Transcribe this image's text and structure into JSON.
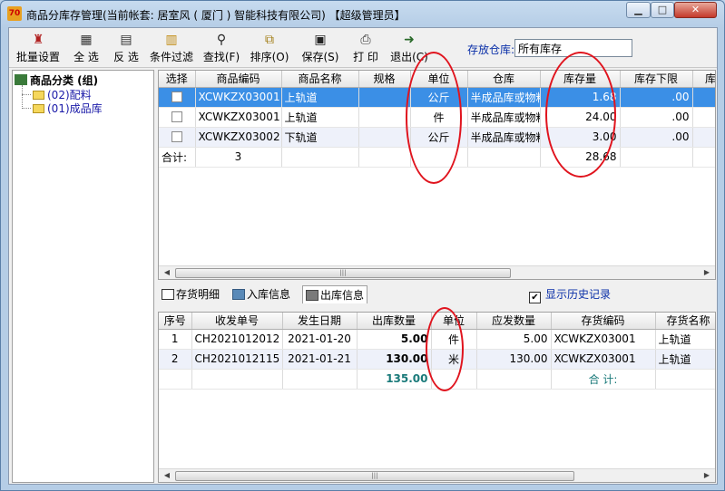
{
  "window": {
    "title": "商品分库存管理(当前帐套: 居室风 ( 厦门 ) 智能科技有限公司) 【超级管理员】",
    "app_icon_text": "70"
  },
  "toolbar": {
    "buttons": [
      {
        "label": "批量设置",
        "icon": "stamp-icon"
      },
      {
        "label": "全 选",
        "icon": "select-all-icon"
      },
      {
        "label": "反 选",
        "icon": "invert-select-icon"
      },
      {
        "label": "条件过滤",
        "icon": "filter-icon"
      },
      {
        "label": "查找(F)",
        "icon": "binoculars-icon"
      },
      {
        "label": "排序(O)",
        "icon": "sort-icon"
      },
      {
        "label": "保存(S)",
        "icon": "save-icon"
      },
      {
        "label": "打 印",
        "icon": "printer-icon"
      },
      {
        "label": "退出(C)",
        "icon": "exit-icon"
      }
    ],
    "store_label": "存放仓库:",
    "store_value": "所有库存"
  },
  "tree": {
    "root": "商品分类 (组)",
    "items": [
      "(02)配料",
      "(01)成品库"
    ]
  },
  "main_grid": {
    "columns": [
      "选择",
      "商品编码",
      "商品名称",
      "规格",
      "单位",
      "仓库",
      "库存量",
      "库存下限",
      "库存"
    ],
    "rows": [
      {
        "code": "XCWKZX03001",
        "name": "上轨道",
        "spec": "",
        "unit": "公斤",
        "warehouse": "半成品库或物料",
        "qty": "1.68",
        "min": ".00"
      },
      {
        "code": "XCWKZX03001",
        "name": "上轨道",
        "spec": "",
        "unit": "件",
        "warehouse": "半成品库或物料",
        "qty": "24.00",
        "min": ".00"
      },
      {
        "code": "XCWKZX03002",
        "name": "下轨道",
        "spec": "",
        "unit": "公斤",
        "warehouse": "半成品库或物料",
        "qty": "3.00",
        "min": ".00"
      }
    ],
    "total_label": "合计:",
    "total_count": "3",
    "total_qty": "28.68"
  },
  "tabs": {
    "items": [
      "存货明细",
      "入库信息",
      "出库信息"
    ],
    "active": 2,
    "history_label": "显示历史记录",
    "history_checked": true
  },
  "detail_grid": {
    "columns": [
      "序号",
      "收发单号",
      "发生日期",
      "出库数量",
      "单位",
      "应发数量",
      "存货编码",
      "存货名称"
    ],
    "rows": [
      {
        "no": "1",
        "doc": "CH2021012012",
        "date": "2021-01-20",
        "out_qty": "5.00",
        "unit": "件",
        "due_qty": "5.00",
        "code": "XCWKZX03001",
        "name": "上轨道"
      },
      {
        "no": "2",
        "doc": "CH2021012115",
        "date": "2021-01-21",
        "out_qty": "130.00",
        "unit": "米",
        "due_qty": "130.00",
        "code": "XCWKZX03001",
        "name": "上轨道"
      }
    ],
    "total_out": "135.00",
    "total_label": "合 计:"
  },
  "colors": {
    "selection": "#3b8fe6",
    "annotation": "#e0141e",
    "link_blue": "#0a2fa8",
    "total_teal": "#1a7a7a"
  }
}
